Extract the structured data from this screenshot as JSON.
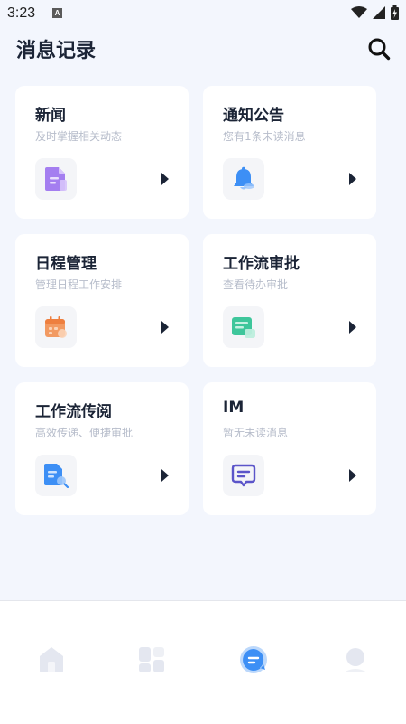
{
  "status_bar": {
    "time": "3:23",
    "notification_badge": "A",
    "icons": [
      "wifi-icon",
      "signal-icon",
      "battery-icon"
    ]
  },
  "header": {
    "title": "消息记录",
    "search_icon": "search-icon"
  },
  "cards": [
    {
      "title": "新闻",
      "subtitle": "及时掌握相关动态",
      "icon": "news-document-icon",
      "accent": "#a47ef0"
    },
    {
      "title": "通知公告",
      "subtitle": "您有1条未读消息",
      "icon": "bell-icon",
      "accent": "#3d8ff5"
    },
    {
      "title": "日程管理",
      "subtitle": "管理日程工作安排",
      "icon": "calendar-icon",
      "accent": "#f29a62"
    },
    {
      "title": "工作流审批",
      "subtitle": "查看待办审批",
      "icon": "approval-form-icon",
      "accent": "#3ec69b"
    },
    {
      "title": "工作流传阅",
      "subtitle": "高效传递、便捷审批",
      "icon": "circulation-document-icon",
      "accent": "#3d8ff5"
    },
    {
      "title": "IM",
      "subtitle": "暂无未读消息",
      "icon": "chat-bubble-icon",
      "accent": "#5b55c9"
    }
  ],
  "bottom_nav": {
    "items": [
      {
        "icon": "home-icon",
        "active": false
      },
      {
        "icon": "apps-grid-icon",
        "active": false
      },
      {
        "icon": "message-icon",
        "active": true
      },
      {
        "icon": "profile-icon",
        "active": false
      }
    ],
    "active_color": "#3d8ff5",
    "inactive_color": "#e4e7f0"
  }
}
